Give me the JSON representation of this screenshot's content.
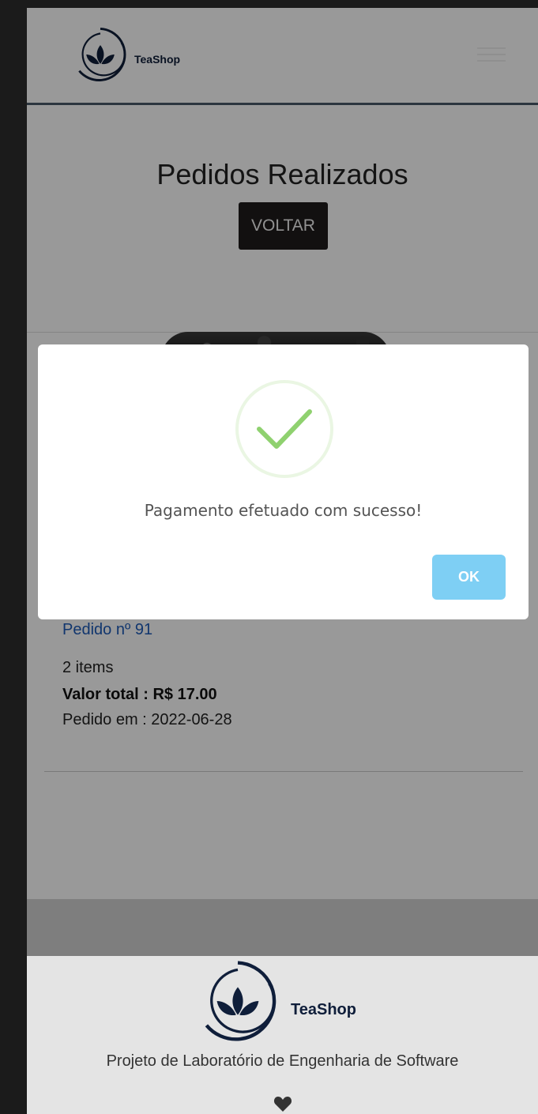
{
  "brand": {
    "name": "TeaShop"
  },
  "page": {
    "title": "Pedidos Realizados",
    "back_button": "VOLTAR"
  },
  "order": {
    "link": "Pedido nº 91",
    "items": "2 items",
    "total": "Valor total : R$ 17.00",
    "date": "Pedido em : 2022-06-28"
  },
  "modal": {
    "message": "Pagamento efetuado com sucesso!",
    "ok_label": "OK",
    "success_color": "#8fd16f"
  },
  "footer": {
    "text": "Projeto de Laboratório de Engenharia de Software",
    "icon": "heart-icon"
  },
  "colors": {
    "link": "#1d5ab8",
    "ok_button": "#7ecff4",
    "brand_navy": "#0f1e3a"
  }
}
